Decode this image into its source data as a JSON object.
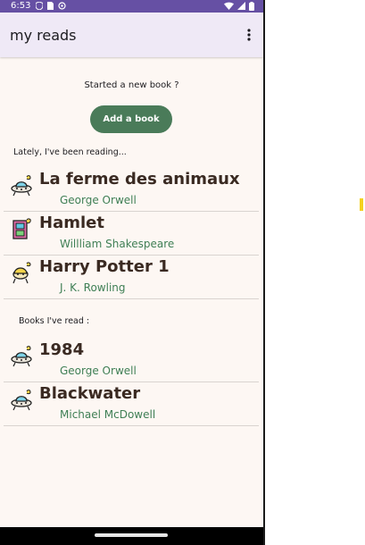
{
  "status_bar": {
    "time": "6:53",
    "background": "#6650a4"
  },
  "app_bar": {
    "title": "my reads",
    "menu_icon": "more-vert-icon"
  },
  "prompt": "Started a new book ?",
  "add_button_label": "Add a book",
  "current_section_label": "Lately, I've been reading...",
  "current_books": [
    {
      "title": "La ferme des animaux",
      "author": "George Orwell",
      "icon": "ufo-icon"
    },
    {
      "title": "Hamlet",
      "author": "Willliam Shakespeare",
      "icon": "book-icon"
    },
    {
      "title": "Harry Potter 1",
      "author": "J. K. Rowling",
      "icon": "wizard-icon"
    }
  ],
  "read_section_label": "Books I've read :",
  "read_books": [
    {
      "title": "1984",
      "author": "George Orwell",
      "icon": "ufo-icon"
    },
    {
      "title": "Blackwater",
      "author": "Michael McDowell",
      "icon": "ufo-icon"
    }
  ],
  "colors": {
    "accent": "#4a7b59",
    "title": "#3a2a22",
    "author": "#3f7f55"
  }
}
